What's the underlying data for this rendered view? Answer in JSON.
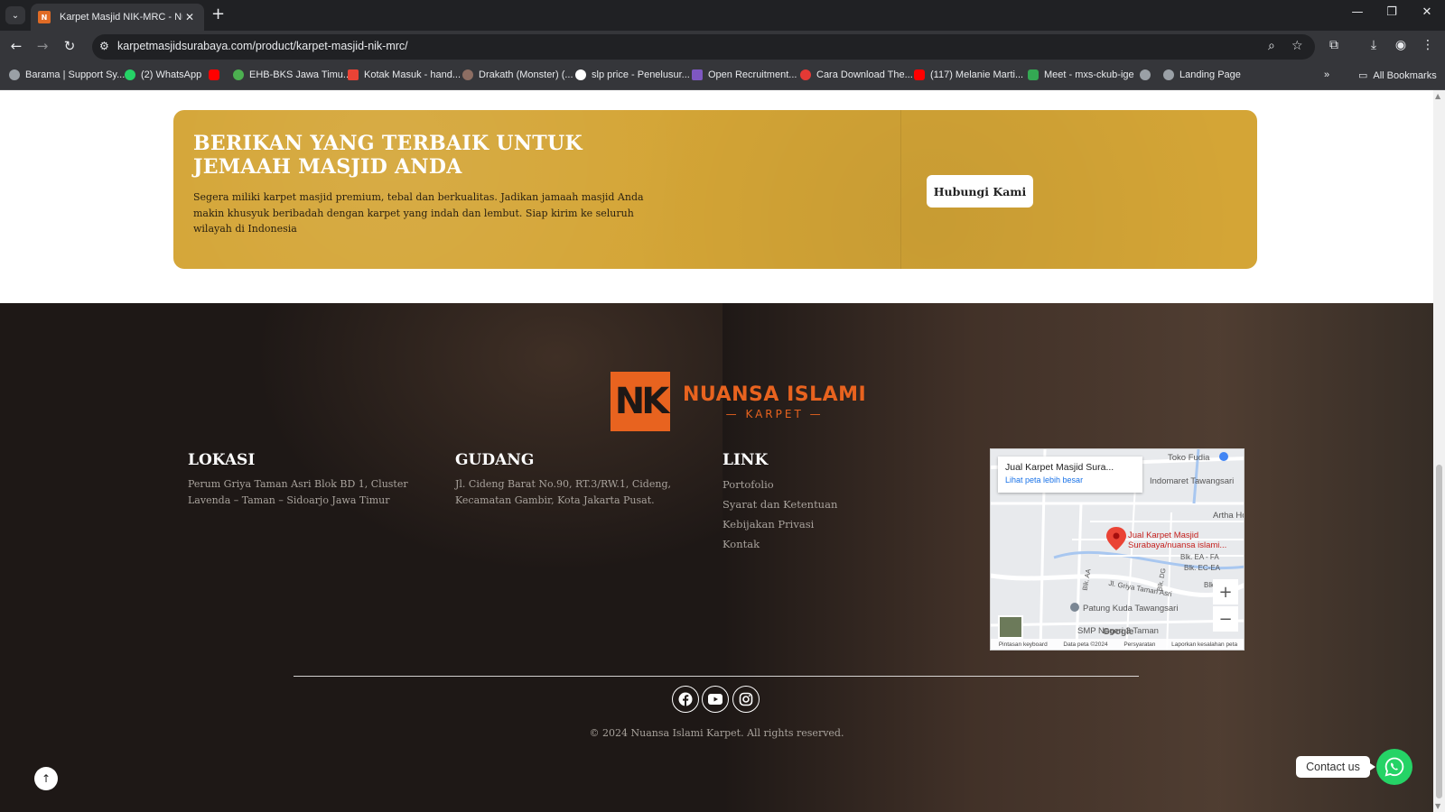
{
  "browser": {
    "tab_title": "Karpet Masjid NIK-MRC - Nuan",
    "url": "karpetmasjidsurabaya.com/product/karpet-masjid-nik-mrc/",
    "bookmarks": [
      {
        "label": "Barama | Support Sy...",
        "color": "#9aa0a6"
      },
      {
        "label": "(2) WhatsApp",
        "color": "#25d366"
      },
      {
        "label": "",
        "color": "#ff0000"
      },
      {
        "label": "EHB-BKS Jawa Timu...",
        "color": "#4caf50"
      },
      {
        "label": "Kotak Masuk - hand...",
        "color": "#ea4335"
      },
      {
        "label": "Drakath (Monster) (...",
        "color": "#8d6e63"
      },
      {
        "label": "slp price - Penelusur...",
        "color": "#ffffff"
      },
      {
        "label": "Open Recruitment...",
        "color": "#7e57c2"
      },
      {
        "label": "Cara Download The...",
        "color": "#e53935"
      },
      {
        "label": "(117) Melanie Marti...",
        "color": "#ff0000"
      },
      {
        "label": "Meet - mxs-ckub-ige",
        "color": "#34a853"
      },
      {
        "label": "",
        "color": "#9aa0a6"
      },
      {
        "label": "Landing Page",
        "color": "#9aa0a6"
      }
    ],
    "all_bookmarks": "All Bookmarks"
  },
  "cta": {
    "title": "Berikan yang terbaik untuk Jemaah Masjid Anda",
    "text": "Segera miliki karpet masjid premium, tebal dan berkualitas. Jadikan jamaah masjid Anda makin khusyuk beribadah dengan karpet yang indah dan lembut. Siap kirim ke seluruh wilayah di Indonesia",
    "button": "Hubungi Kami",
    "accent": "#d4a536"
  },
  "footer": {
    "logo_mark": "NK",
    "logo_main": "NUANSA ISLAMI",
    "logo_sub": "KARPET",
    "brand_color": "#e8631f",
    "lokasi": {
      "title": "Lokasi",
      "text": "Perum Griya Taman Asri  Blok BD 1, Cluster Lavenda – Taman  – Sidoarjo Jawa Timur"
    },
    "gudang": {
      "title": "Gudang",
      "text": "Jl. Cideng Barat No.90, RT.3/RW.1, Cideng, Kecamatan Gambir, Kota Jakarta Pusat."
    },
    "link": {
      "title": "Link",
      "items": [
        "Portofolio",
        "Syarat dan Ketentuan",
        "Kebijakan Privasi",
        "Kontak"
      ]
    },
    "map": {
      "card_title": "Jual Karpet Masjid Sura...",
      "card_link": "Lihat peta lebih besar",
      "place_label_1": "Jual Karpet Masjid",
      "place_label_2": "Surabaya/nuansa islami...",
      "labels": [
        "Toko Fudia",
        "Indomaret Tawangsari",
        "Artha Hom",
        "Blk. EA - FA",
        "Blk. EC-EA",
        "Blk. E",
        "Jl. Griya Taman Asri",
        "Blk. AA",
        "Blk. DG",
        "Patung Kuda Tawangsari",
        "SMP Negeri 3 Taman"
      ],
      "zoom_in": "+",
      "zoom_out": "−",
      "footer": [
        "Pintasan keyboard",
        "Data peta ©2024",
        "Persyaratan",
        "Laporkan kesalahan peta"
      ],
      "google": "Google"
    },
    "social": [
      "facebook-icon",
      "youtube-icon",
      "instagram-icon"
    ],
    "copyright": "© 2024 Nuansa Islami Karpet. All rights reserved."
  },
  "floating": {
    "back_to_top": "↑",
    "contact_label": "Contact us"
  }
}
